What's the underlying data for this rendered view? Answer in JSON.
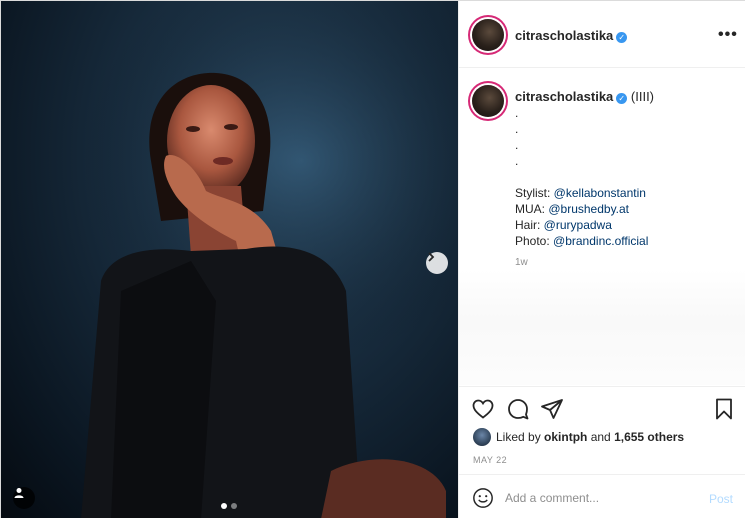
{
  "post": {
    "author": "citrascholastika",
    "verified": true,
    "more_icon": "more-horizontal-icon"
  },
  "media": {
    "next_icon": "chevron-right-icon",
    "user_tag_icon": "person-icon",
    "carousel_count": 2,
    "carousel_active": 1
  },
  "caption": {
    "username": "citrascholastika",
    "suffix": "(IIII)",
    "dots": [
      ".",
      ".",
      ".",
      "."
    ],
    "credits": [
      {
        "label": "Stylist: ",
        "mention": "@kellabonstantin"
      },
      {
        "label": "MUA: ",
        "mention": "@brushedby.at"
      },
      {
        "label": "Hair: ",
        "mention": "@rurypadwa"
      },
      {
        "label": "Photo: ",
        "mention": "@brandinc.official"
      }
    ],
    "time": "1w"
  },
  "actions": {
    "liked_by_prefix": "Liked by ",
    "liked_by_user": "okintph",
    "liked_by_and": " and ",
    "liked_by_others": "1,655 others",
    "date": "MAY 22"
  },
  "comment": {
    "placeholder": "Add a comment...",
    "post_label": "Post"
  },
  "colors": {
    "verified": "#3897f0",
    "mention": "#00376b",
    "post_disabled": "#b3dbff",
    "story_ring": "#d62976"
  }
}
